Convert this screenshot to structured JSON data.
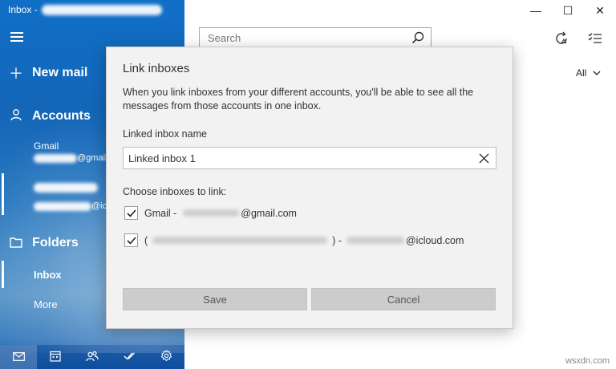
{
  "window": {
    "title": "Inbox - ",
    "controls": {
      "minimize": "—",
      "maximize": "☐",
      "close": "✕"
    }
  },
  "sidebar": {
    "new_mail": "New mail",
    "accounts": "Accounts",
    "account1": {
      "name": "Gmail",
      "suffix": "@gmail"
    },
    "account2": {
      "suffix": "@icl"
    },
    "folders": "Folders",
    "inbox": "Inbox",
    "more": "More"
  },
  "search": {
    "placeholder": "Search"
  },
  "filter": {
    "label": "All"
  },
  "dialog": {
    "title": "Link inboxes",
    "description": "When you link inboxes from your different accounts, you'll be able to see all the messages from those accounts in one inbox.",
    "name_label": "Linked inbox name",
    "name_value": "Linked inbox 1",
    "choose_label": "Choose inboxes to link:",
    "inboxes": [
      {
        "prefix": "Gmail -",
        "suffix": "@gmail.com",
        "checked": true
      },
      {
        "prefix": "(",
        "middle": ") -",
        "suffix": "@icloud.com",
        "checked": true
      }
    ],
    "save": "Save",
    "cancel": "Cancel"
  },
  "watermark": "wsxdn.com"
}
